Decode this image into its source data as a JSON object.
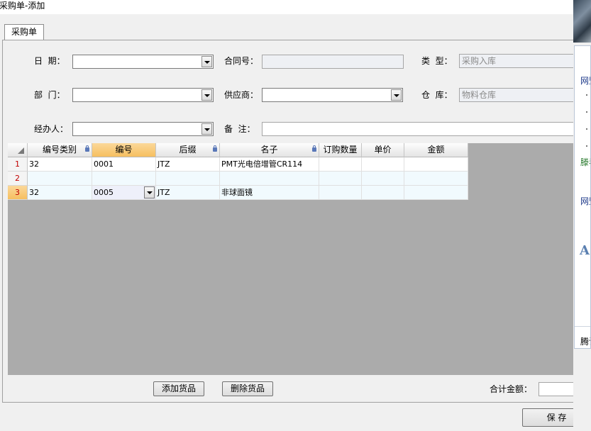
{
  "window": {
    "title": "采购单-添加"
  },
  "tab": {
    "label": "采购单"
  },
  "form": {
    "date_label": "日  期：",
    "contract_label": "合同号：",
    "type_label": "类  型：",
    "type_value": "采购入库",
    "dept_label": "部  门：",
    "supplier_label": "供应商：",
    "warehouse_label": "仓  库：",
    "warehouse_value": "物料仓库",
    "handler_label": "经办人：",
    "note_label": "备  注："
  },
  "grid": {
    "columns": [
      "编号类别",
      "编号",
      "后缀",
      "名子",
      "订购数量",
      "单价",
      "金额"
    ],
    "rows": [
      {
        "num": "1",
        "cat": "32",
        "code": "0001",
        "suffix": "JTZ",
        "name": "PMT光电倍增管CR114",
        "qty": "",
        "price": "",
        "amount": ""
      },
      {
        "num": "2",
        "cat": "",
        "code": "",
        "suffix": "",
        "name": "",
        "qty": "",
        "price": "",
        "amount": ""
      },
      {
        "num": "3",
        "cat": "32",
        "code": "0005",
        "suffix": "JTZ",
        "name": "非球面镜",
        "qty": "",
        "price": "",
        "amount": ""
      }
    ]
  },
  "buttons": {
    "add": "添加货品",
    "delete": "删除货品",
    "save": "保 存"
  },
  "total": {
    "label": "合计金额："
  },
  "side": {
    "t1": "网盟",
    "t2": "滕看",
    "t3": "网盟",
    "t4": "A",
    "t5": "腾讯"
  }
}
